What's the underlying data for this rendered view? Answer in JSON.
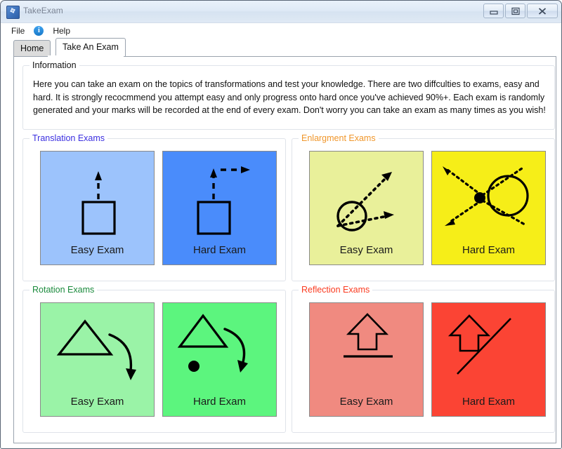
{
  "window": {
    "title": "TakeExam",
    "icon": "app-icon",
    "buttons": {
      "minimize": "Minimize",
      "maximize": "Restore",
      "close": "Close"
    }
  },
  "menubar": {
    "items": [
      {
        "label": "File",
        "icon": null
      },
      {
        "label": "",
        "icon": "info-icon"
      },
      {
        "label": "Help",
        "icon": null
      }
    ],
    "file_label": "File",
    "help_label": "Help",
    "info_glyph": "i"
  },
  "tabs": [
    {
      "label": "Home",
      "active": false
    },
    {
      "label": "Take An Exam",
      "active": true
    }
  ],
  "information": {
    "title": "Information",
    "body": "Here you can take an exam on the topics of transformations and test your knowledge. There are two diffculties to exams, easy and hard. It is strongly recocmmend you attempt easy and only progress onto hard once you've achieved 90%+. Each exam is randomly generated and your marks will be recorded at the end of every exam. Don't worry you can take an exam as many times as you wish!"
  },
  "groups": {
    "translation": {
      "title": "Translation Exams",
      "title_color": "#3b2fe0",
      "easy": {
        "label": "Easy Exam",
        "color": "#9cc3fc",
        "art": "square-with-up-arrow"
      },
      "hard": {
        "label": "Hard Exam",
        "color": "#4a8cfb",
        "art": "square-with-up-and-right-arrows"
      }
    },
    "enlargement": {
      "title": "Enlargment Exams",
      "title_color": "#f0962a",
      "easy": {
        "label": "Easy Exam",
        "color": "#e9f09a",
        "art": "circle-with-two-rays"
      },
      "hard": {
        "label": "Hard Exam",
        "color": "#f6ee18",
        "art": "center-point-with-crossed-rays-and-circle"
      }
    },
    "rotation": {
      "title": "Rotation Exams",
      "title_color": "#1a8a3c",
      "easy": {
        "label": "Easy Exam",
        "color": "#9af3a7",
        "art": "triangle-with-curved-arrow"
      },
      "hard": {
        "label": "Hard Exam",
        "color": "#5cf57e",
        "art": "triangle-with-curved-arrow-and-center-dot"
      }
    },
    "reflection": {
      "title": "Reflection Exams",
      "title_color": "#fa3b20",
      "easy": {
        "label": "Easy Exam",
        "color": "#f08a80",
        "art": "arrow-with-horizontal-mirror-line"
      },
      "hard": {
        "label": "Hard Exam",
        "color": "#fb4434",
        "art": "arrow-with-diagonal-mirror-line"
      }
    }
  }
}
